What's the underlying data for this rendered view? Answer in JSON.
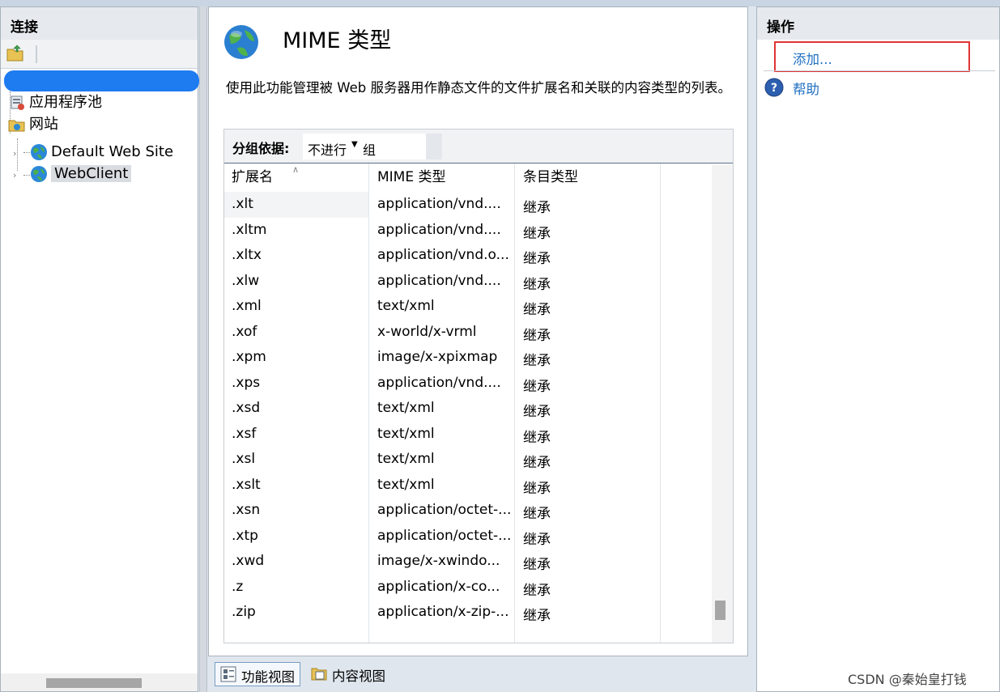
{
  "connections": {
    "title": "连接",
    "tree": [
      {
        "label": "应用程序池",
        "icon": "app-pool-icon"
      },
      {
        "label": "网站",
        "icon": "sites-folder-icon"
      },
      {
        "label": "Default Web Site",
        "icon": "globe-icon"
      },
      {
        "label": "WebClient",
        "icon": "globe-icon",
        "selected": true
      }
    ]
  },
  "feature": {
    "title": "MIME 类型",
    "description": "使用此功能管理被 Web 服务器用作静态文件的文件扩展名和关联的内容类型的列表。",
    "group_by_label": "分组依据:",
    "group_by_value_a": "不进行",
    "group_by_value_b": "组",
    "columns": [
      "扩展名",
      "MIME 类型",
      "条目类型"
    ],
    "rows": [
      [
        ".xlt",
        "application/vnd....",
        "继承"
      ],
      [
        ".xltm",
        "application/vnd....",
        "继承"
      ],
      [
        ".xltx",
        "application/vnd.o...",
        "继承"
      ],
      [
        ".xlw",
        "application/vnd....",
        "继承"
      ],
      [
        ".xml",
        "text/xml",
        "继承"
      ],
      [
        ".xof",
        "x-world/x-vrml",
        "继承"
      ],
      [
        ".xpm",
        "image/x-xpixmap",
        "继承"
      ],
      [
        ".xps",
        "application/vnd....",
        "继承"
      ],
      [
        ".xsd",
        "text/xml",
        "继承"
      ],
      [
        ".xsf",
        "text/xml",
        "继承"
      ],
      [
        ".xsl",
        "text/xml",
        "继承"
      ],
      [
        ".xslt",
        "text/xml",
        "继承"
      ],
      [
        ".xsn",
        "application/octet-...",
        "继承"
      ],
      [
        ".xtp",
        "application/octet-...",
        "继承"
      ],
      [
        ".xwd",
        "image/x-xwindo...",
        "继承"
      ],
      [
        ".z",
        "application/x-co...",
        "继承"
      ],
      [
        ".zip",
        "application/x-zip-...",
        "继承"
      ]
    ]
  },
  "view_tabs": {
    "features": "功能视图",
    "content": "内容视图"
  },
  "actions": {
    "title": "操作",
    "add": "添加...",
    "help": "帮助"
  },
  "watermark": "CSDN @秦始皇打钱",
  "colors": {
    "link": "#1f6fc1",
    "highlight": "#e03434",
    "redaction": "#1e7bf0"
  }
}
